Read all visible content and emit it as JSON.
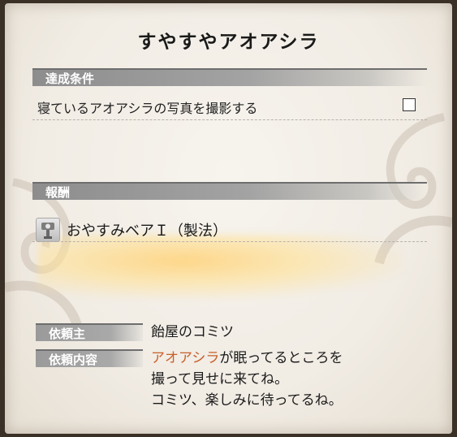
{
  "quest": {
    "title": "すやすやアオアシラ"
  },
  "conditions": {
    "header": "達成条件",
    "items": [
      {
        "text": "寝ているアオアシラの写真を撮影する",
        "checked": false
      }
    ]
  },
  "rewards": {
    "header": "報酬",
    "items": [
      {
        "icon": "bowgun-blueprint-icon",
        "label": "おやすみベアＩ（製法）"
      }
    ]
  },
  "info": {
    "client_label": "依頼主",
    "client_value": "飴屋のコミツ",
    "details_label": "依頼内容",
    "details_highlight": "アオアシラ",
    "details_line1_rest": "が眠ってるところを",
    "details_line2": "撮って見せに来てね。",
    "details_line3": "コミツ、楽しみに待ってるね。"
  },
  "colors": {
    "accent": "#c8602a",
    "band": "#9a9a9a"
  }
}
